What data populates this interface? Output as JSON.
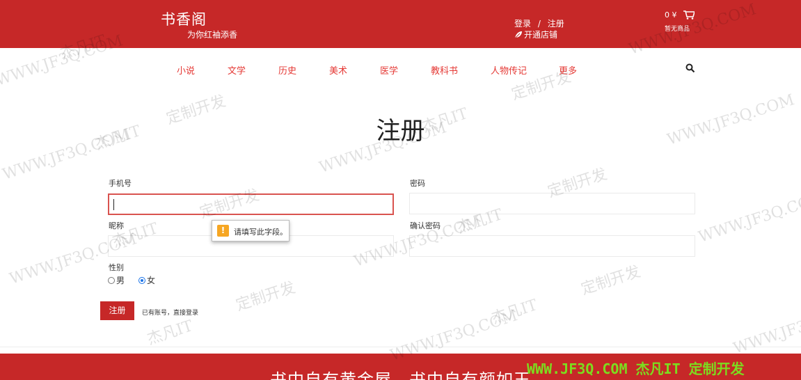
{
  "header": {
    "brand": "书香阁",
    "slogan": "为你红袖添香",
    "login": "登录",
    "separator": "/",
    "register": "注册",
    "open_shop": "开通店铺",
    "cart_amount": "0 ¥",
    "cart_empty": "暂无商品",
    "bg_color": "#c62828"
  },
  "nav": {
    "items": [
      "小说",
      "文学",
      "历史",
      "美术",
      "医学",
      "教科书",
      "人物传记",
      "更多"
    ],
    "accent_color": "#e53935",
    "search_icon": "search-icon"
  },
  "form": {
    "title": "注册",
    "phone_label": "手机号",
    "password_label": "密码",
    "nickname_label": "昵称",
    "confirm_label": "确认密码",
    "gender_label": "性别",
    "gender_options": [
      "男",
      "女"
    ],
    "gender_selected": "女",
    "validation_tip": "请填写此字段。",
    "submit_label": "注册",
    "login_link": "已有账号，直接登录"
  },
  "footer": {
    "slogan": "书中自有黄金屋，书中自有颜如玉"
  },
  "watermark": {
    "site": "WWW.JF3Q.COM",
    "name": "杰凡IT",
    "service": "定制开发",
    "bottom": "WWW.JF3Q.COM 杰凡IT  定制开发"
  }
}
